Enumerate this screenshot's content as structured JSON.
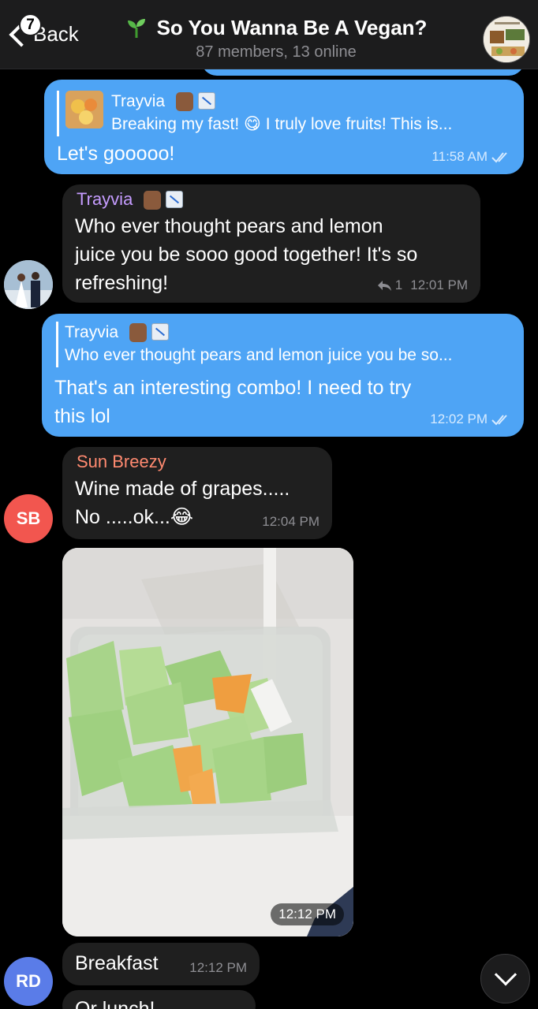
{
  "header": {
    "back_label": "Back",
    "unread_badge": "7",
    "title": "So You Wanna Be A Vegan?",
    "subtitle": "87 members, 13 online"
  },
  "messages": [
    {
      "direction": "outgoing",
      "reply": {
        "name": "Trayvia",
        "text": "Breaking my fast! 😋 I truly love fruits! This is..."
      },
      "text": "Let's gooooo!",
      "time": "11:58 AM"
    },
    {
      "direction": "incoming",
      "sender": "Trayvia",
      "text_lines": [
        "Who ever thought pears and lemon",
        "juice you be sooo good together! It's so",
        "refreshing!"
      ],
      "reply_count": "1",
      "time": "12:01 PM"
    },
    {
      "direction": "outgoing",
      "reply": {
        "name": "Trayvia",
        "text": "Who ever thought pears and lemon juice you be so..."
      },
      "text_lines": [
        "That's an interesting combo! I need to try",
        "this lol"
      ],
      "time": "12:02 PM"
    },
    {
      "direction": "incoming",
      "sender": "Sun Breezy",
      "avatar_initials": "SB",
      "text_lines": [
        "Wine made of grapes.....",
        "No .....ok...😂"
      ],
      "time": "12:04 PM"
    },
    {
      "direction": "incoming",
      "type": "photo",
      "time": "12:12 PM"
    },
    {
      "direction": "incoming",
      "avatar_initials": "RD",
      "text": "Breakfast",
      "time": "12:12 PM"
    },
    {
      "direction": "incoming",
      "text": "Or lunch!"
    }
  ],
  "colors": {
    "outgoing_bubble": "#4ea4f5",
    "incoming_bubble": "#1f1f1f",
    "trayvia_name": "#c59cff",
    "sunbreezy_name": "#ff8a70",
    "sb_avatar": "#f2564f",
    "rd_avatar": "#5a7ce8"
  },
  "icons": {
    "back": "chevron-left-icon",
    "title_emoji": "seedling-icon",
    "reply_arrow": "reply-arrow-icon",
    "read_receipt": "double-check-icon",
    "scroll_down": "chevron-down-icon"
  }
}
